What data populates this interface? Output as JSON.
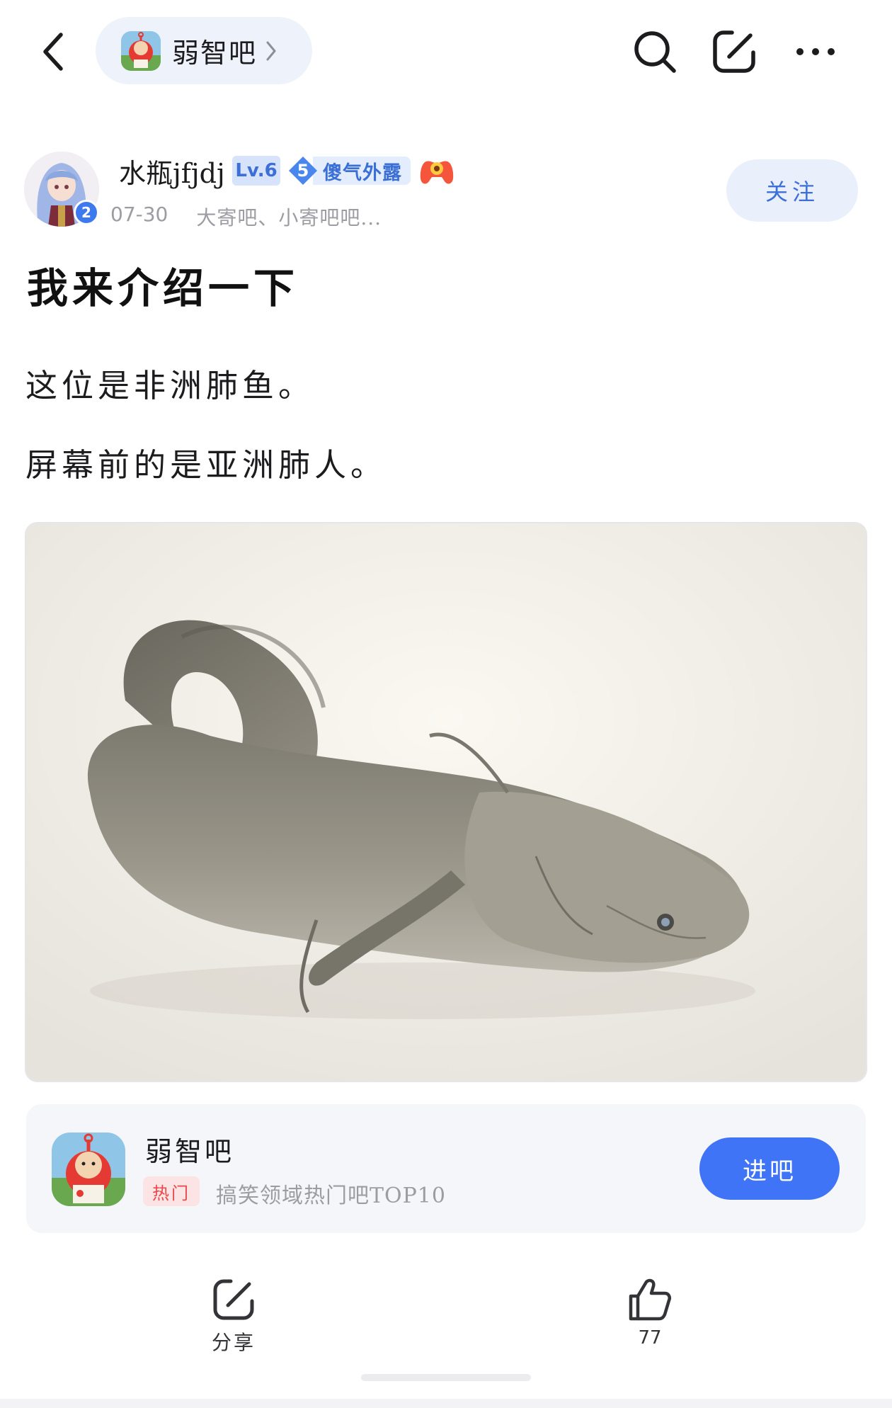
{
  "header": {
    "back_icon": "chevron-left-icon",
    "forum_pill_name": "弱智吧",
    "icons": [
      "search-icon",
      "edit-icon",
      "more-icon"
    ]
  },
  "author": {
    "name": "水瓶jfjdj",
    "level": "Lv.6",
    "avatar_badge": "2",
    "title_badge_level": "5",
    "title_badge_text": "傻气外露",
    "date": "07-30",
    "forums": "大寄吧、小寄吧吧...",
    "follow_label": "关注"
  },
  "post": {
    "title": "我来介绍一下",
    "line1": "这位是非洲肺鱼。",
    "line2": "屏幕前的是亚洲肺人。"
  },
  "forum_card": {
    "name": "弱智吧",
    "hot_tag": "热门",
    "description": "搞笑领域热门吧TOP10",
    "enter_label": "进吧"
  },
  "actions": {
    "share_label": "分享",
    "like_count": "77"
  },
  "colors": {
    "accent_blue": "#3f74f6",
    "pill_bg": "#eef2fa",
    "hot_red": "#e8474b",
    "meta_gray": "#9c9ca3"
  }
}
